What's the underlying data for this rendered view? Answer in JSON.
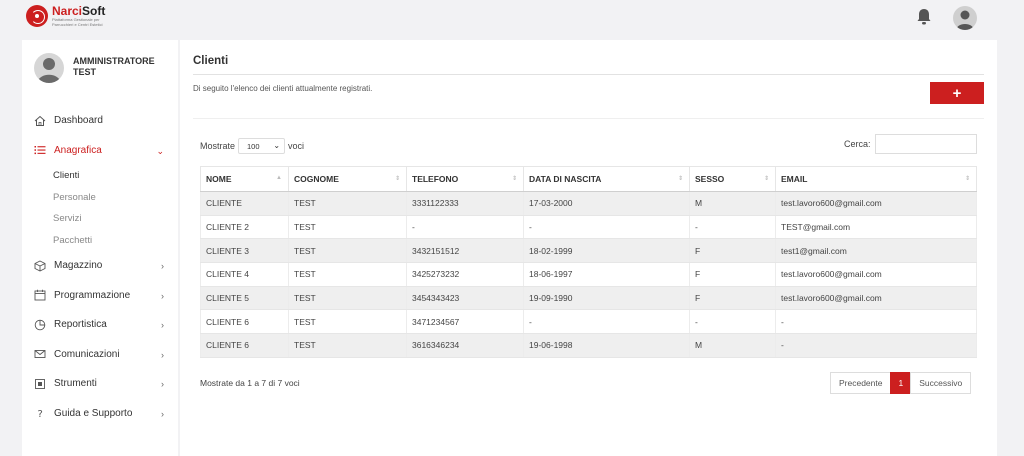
{
  "brand": {
    "name_part1": "Narci",
    "name_part2": "Soft",
    "tagline": "Piattaforma Gestionale per Parrucchieri e Centri Estetici"
  },
  "user": {
    "name_line1": "AMMINISTRATORE",
    "name_line2": "TEST"
  },
  "nav": {
    "items": [
      {
        "label": "Dashboard",
        "icon": "home-icon"
      },
      {
        "label": "Anagrafica",
        "icon": "list-icon",
        "active": true
      },
      {
        "label": "Magazzino",
        "icon": "box-icon"
      },
      {
        "label": "Programmazione",
        "icon": "calendar-icon"
      },
      {
        "label": "Reportistica",
        "icon": "pie-chart-icon"
      },
      {
        "label": "Comunicazioni",
        "icon": "mail-icon"
      },
      {
        "label": "Strumenti",
        "icon": "tool-icon"
      },
      {
        "label": "Guida e Supporto",
        "icon": "question-icon"
      }
    ],
    "sub_items": [
      {
        "label": "Clienti",
        "active": true
      },
      {
        "label": "Personale"
      },
      {
        "label": "Servizi"
      },
      {
        "label": "Pacchetti"
      }
    ]
  },
  "page": {
    "title": "Clienti",
    "subtitle": "Di seguito l'elenco dei clienti attualmente registrati.",
    "add_label": "+"
  },
  "table_controls": {
    "show_prefix": "Mostrate",
    "show_value": "100",
    "show_suffix": "voci",
    "search_label": "Cerca:",
    "search_value": ""
  },
  "table": {
    "headers": [
      "NOME",
      "COGNOME",
      "TELEFONO",
      "DATA DI NASCITA",
      "SESSO",
      "EMAIL"
    ],
    "rows": [
      [
        "CLIENTE",
        "TEST",
        "3331122333",
        "17-03-2000",
        "M",
        "test.lavoro600@gmail.com"
      ],
      [
        "CLIENTE 2",
        "TEST",
        "-",
        "-",
        "-",
        "TEST@gmail.com"
      ],
      [
        "CLIENTE 3",
        "TEST",
        "3432151512",
        "18-02-1999",
        "F",
        "test1@gmail.com"
      ],
      [
        "CLIENTE 4",
        "TEST",
        "3425273232",
        "18-06-1997",
        "F",
        "test.lavoro600@gmail.com"
      ],
      [
        "CLIENTE 5",
        "TEST",
        "3454343423",
        "19-09-1990",
        "F",
        "test.lavoro600@gmail.com"
      ],
      [
        "CLIENTE 6",
        "TEST",
        "3471234567",
        "-",
        "-",
        "-"
      ],
      [
        "CLIENTE 6",
        "TEST",
        "3616346234",
        "19-06-1998",
        "M",
        "-"
      ]
    ]
  },
  "footer": {
    "info": "Mostrate da 1 a 7 di 7 voci",
    "prev": "Precedente",
    "page": "1",
    "next": "Successivo"
  },
  "colors": {
    "accent": "#cc1f1f",
    "background": "#f2f2f4"
  }
}
